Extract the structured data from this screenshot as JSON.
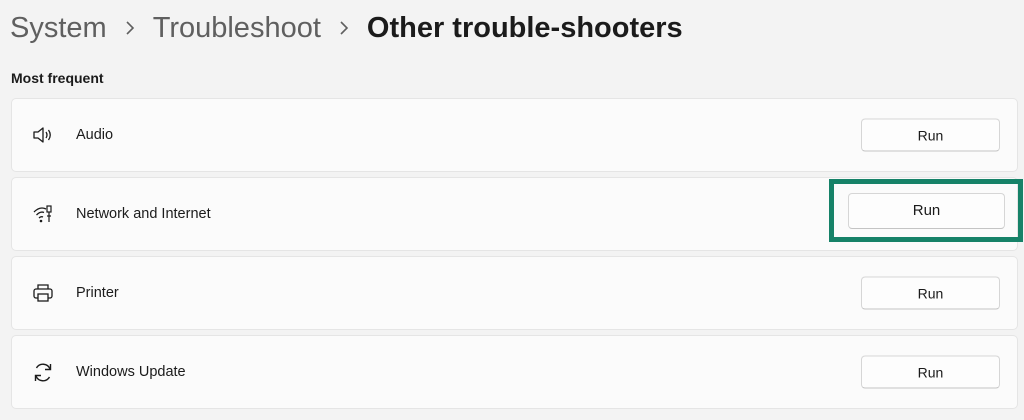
{
  "breadcrumb": {
    "items": [
      "System",
      "Troubleshoot",
      "Other trouble-shooters"
    ]
  },
  "section": {
    "title": "Most frequent"
  },
  "troubleshooters": [
    {
      "label": "Audio",
      "icon": "speaker-icon",
      "button": "Run"
    },
    {
      "label": "Network and Internet",
      "icon": "network-icon",
      "button": "Run",
      "highlighted": true
    },
    {
      "label": "Printer",
      "icon": "printer-icon",
      "button": "Run"
    },
    {
      "label": "Windows Update",
      "icon": "sync-icon",
      "button": "Run"
    }
  ],
  "colors": {
    "background": "#f3f3f3",
    "card": "#fbfbfb",
    "highlight": "#168268"
  }
}
